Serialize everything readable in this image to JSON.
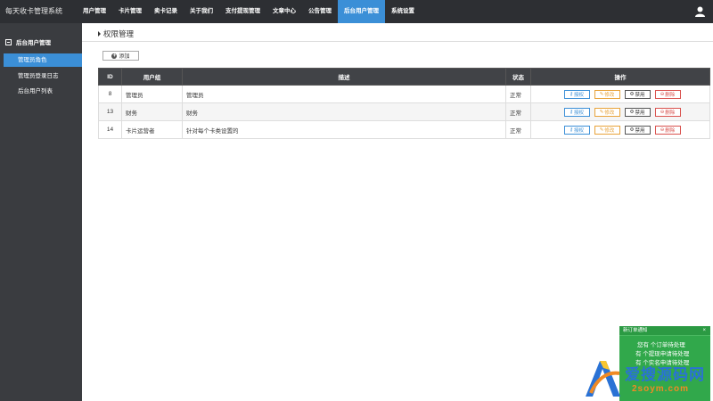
{
  "header": {
    "brand": "每天收卡管理系统",
    "nav": [
      "用户管理",
      "卡片管理",
      "卖卡记录",
      "关于我们",
      "支付提现管理",
      "文章中心",
      "公告管理",
      "后台用户管理",
      "系统设置"
    ],
    "active_index": 7
  },
  "sidebar": {
    "group": "后台用户管理",
    "items": [
      "管理员角色",
      "管理员登录日志",
      "后台用户列表"
    ],
    "active_index": 0
  },
  "main": {
    "title": "权限管理",
    "add_label": "添加",
    "table": {
      "headers": [
        "ID",
        "用户组",
        "描述",
        "状态",
        "操作"
      ],
      "rows": [
        {
          "id": "8",
          "group": "管理员",
          "desc": "管理员",
          "status": "正常"
        },
        {
          "id": "13",
          "group": "财务",
          "desc": "财务",
          "status": "正常"
        },
        {
          "id": "14",
          "group": "卡片运营者",
          "desc": "针对每个卡类设置的",
          "status": "正常"
        }
      ],
      "actions": [
        "授权",
        "修改",
        "禁用",
        "删除"
      ]
    }
  },
  "notification": {
    "title": "新订单通知",
    "close": "×",
    "lines": [
      "您有  个订单待处理",
      "有  个提现申请待处理",
      "有  个实名申请待处理"
    ]
  },
  "watermark": {
    "main": "爱搜源码网",
    "sub": "2soym.com"
  },
  "colors": {
    "accent": "#3b8fd7",
    "topbar": "#2d2f33",
    "sidebar": "#3a3c40",
    "notify": "#31a84b"
  }
}
